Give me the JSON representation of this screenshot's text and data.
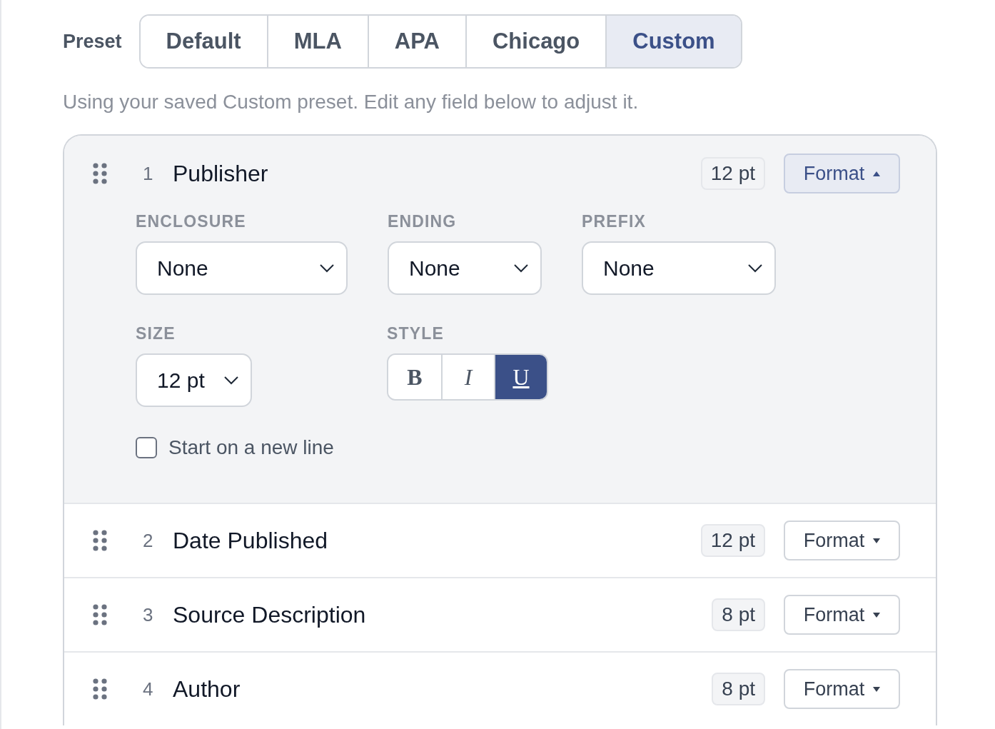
{
  "preset": {
    "label": "Preset",
    "options": [
      {
        "label": "Default",
        "selected": false
      },
      {
        "label": "MLA",
        "selected": false
      },
      {
        "label": "APA",
        "selected": false
      },
      {
        "label": "Chicago",
        "selected": false
      },
      {
        "label": "Custom",
        "selected": true
      }
    ],
    "hint": "Using your saved Custom preset. Edit any field below to adjust it."
  },
  "fields": [
    {
      "number": "1",
      "name": "Publisher",
      "size": "12 pt",
      "format": "Format",
      "expanded": true,
      "options": {
        "selects": [
          {
            "label": "ENCLOSURE",
            "value": "None"
          },
          {
            "label": "ENDING",
            "value": "None"
          },
          {
            "label": "PREFIX",
            "value": "None"
          }
        ],
        "size": {
          "label": "SIZE",
          "value": "12 pt"
        },
        "style": {
          "label": "STYLE",
          "buttons": [
            {
              "kind": "bold",
              "label": "B",
              "selected": false
            },
            {
              "kind": "italic",
              "label": "I",
              "selected": false
            },
            {
              "kind": "underline",
              "label": "U",
              "selected": true
            }
          ]
        },
        "newline": {
          "label": "Start on a new line",
          "checked": false
        }
      }
    },
    {
      "number": "2",
      "name": "Date Published",
      "size": "12 pt",
      "format": "Format",
      "expanded": false
    },
    {
      "number": "3",
      "name": "Source Description",
      "size": "8 pt",
      "format": "Format",
      "expanded": false
    },
    {
      "number": "4",
      "name": "Author",
      "size": "8 pt",
      "format": "Format",
      "expanded": false
    }
  ]
}
